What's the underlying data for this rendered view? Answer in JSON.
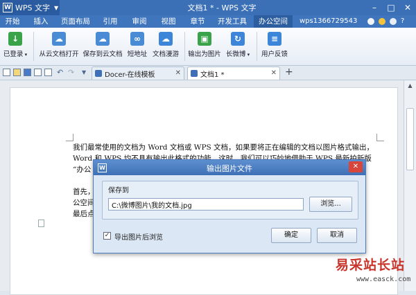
{
  "app": {
    "logo_label": "WPS 文字",
    "window_title": "文档1 * - WPS 文字"
  },
  "menu": {
    "items": [
      "开始",
      "插入",
      "页面布局",
      "引用",
      "审阅",
      "视图",
      "章节",
      "开发工具",
      "办公空间"
    ],
    "active_index": 8,
    "account": "wps1366729543"
  },
  "ribbon": {
    "buttons": [
      {
        "label": "已登录",
        "icon": "cloud-login-icon",
        "color": "#3aa34a"
      },
      {
        "label": "从云文档打开",
        "icon": "cloud-open-icon",
        "color": "#4a8bd6"
      },
      {
        "label": "保存到云文档",
        "icon": "cloud-save-icon",
        "color": "#4a8bd6"
      },
      {
        "label": "短地址",
        "icon": "link-icon",
        "color": "#4a8bd6"
      },
      {
        "label": "文档漫游",
        "icon": "cloud-roam-icon",
        "color": "#3d85d8"
      },
      {
        "label": "输出为图片",
        "icon": "export-image-icon",
        "color": "#3aa34a"
      },
      {
        "label": "长微博",
        "icon": "weibo-icon",
        "color": "#3d85d8"
      },
      {
        "label": "用户反馈",
        "icon": "feedback-icon",
        "color": "#3d85d8"
      }
    ]
  },
  "tabs": {
    "items": [
      "Docer-在线模板",
      "文档1 *"
    ],
    "active_index": 1,
    "add_label": "+"
  },
  "document": {
    "paragraphs": [
      "我们最常使用的文档为 Word 文档或 WPS 文档，如果要将正在编辑的文档以图片格式输出，",
      "Word 和 WPS 均不具有输出此格式的功能，这时，我们可以巧妙地借助于 WPS 最新拍新版",
      "“办公",
      "首先，",
      "公空间",
      "最后点"
    ]
  },
  "dialog": {
    "title": "输出图片文件",
    "group_label": "保存到",
    "path_value": "C:\\微博图片\\我的文档.jpg",
    "browse_label": "浏览...",
    "checkbox_label": "导出图片后浏览",
    "checkbox_checked": true,
    "ok_label": "确定",
    "cancel_label": "取消",
    "close_label": "✕"
  },
  "watermark": {
    "cn": "易采站长站",
    "url": "www.easck.com"
  }
}
